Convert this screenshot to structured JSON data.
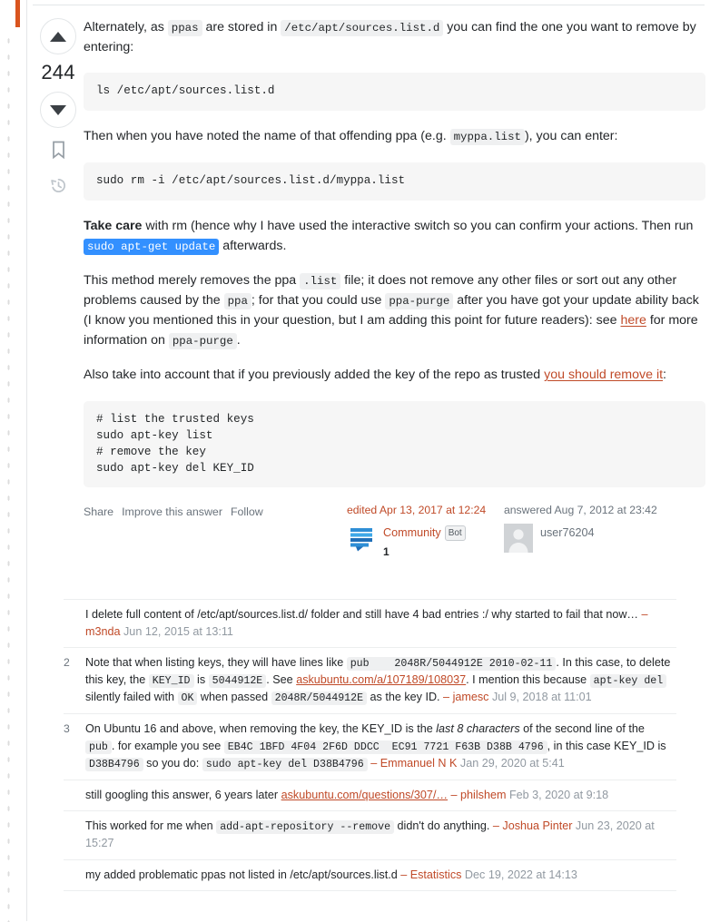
{
  "gutter": {
    "vote_count": "244",
    "upvote_label": "Up vote",
    "downvote_label": "Down vote",
    "bookmark_label": "Save this answer",
    "history_label": "Timeline"
  },
  "answer": {
    "paragraphs": {
      "p1_a": "Alternately, as ",
      "p1_code1": "ppas",
      "p1_b": " are stored in ",
      "p1_code2": "/etc/apt/sources.list.d",
      "p1_c": " you can find the one you want to remove by entering:",
      "pre1": "ls /etc/apt/sources.list.d",
      "p2_a": "Then when you have noted the name of that offending ppa (e.g. ",
      "p2_code1": "myppa.list",
      "p2_b": "), you can enter:",
      "pre2": "sudo rm -i /etc/apt/sources.list.d/myppa.list",
      "p3_bold": "Take care",
      "p3_a": " with rm (hence why I have used the interactive switch so you can confirm your actions. Then run ",
      "p3_code_selected": "sudo apt-get update",
      "p3_b": " afterwards.",
      "p4_a": "This method merely removes the ppa ",
      "p4_code1": ".list",
      "p4_b": " file; it does not remove any other files or sort out any other problems caused by the ",
      "p4_code2": "ppa",
      "p4_c": "; for that you could use ",
      "p4_code3": "ppa-purge",
      "p4_d": " after you have got your update ability back (I know you mentioned this in your question, but I am adding this point for future readers): see ",
      "p4_link": "here",
      "p4_e": " for more information on ",
      "p4_code4": "ppa-purge",
      "p4_f": ".",
      "p5_a": "Also take into account that if you previously added the key of the repo as trusted ",
      "p5_link": "you should remove it",
      "p5_b": ":",
      "pre3": "# list the trusted keys\nsudo apt-key list\n# remove the key\nsudo apt-key del KEY_ID"
    },
    "actions": {
      "share": "Share",
      "improve": "Improve this answer",
      "follow": "Follow"
    },
    "edited": {
      "when": "edited Apr 13, 2017 at 12:24",
      "user": "Community",
      "badge": "Bot",
      "rep": "1",
      "avatar_icon": "community-bot-avatar"
    },
    "answered": {
      "when": "answered Aug 7, 2012 at 23:42",
      "user": "user76204",
      "avatar_icon": "default-user-avatar"
    }
  },
  "comments": [
    {
      "score": "",
      "segments": [
        {
          "t": "text",
          "v": "I delete full content of /etc/apt/sources.list.d/ folder and still have 4 bad entries :/ why started to fail that now… "
        },
        {
          "t": "dash",
          "v": "– "
        },
        {
          "t": "user",
          "v": "m3nda"
        },
        {
          "t": "date",
          "v": " Jun 12, 2015 at 13:11"
        }
      ]
    },
    {
      "score": "2",
      "segments": [
        {
          "t": "text",
          "v": "Note that when listing keys, they will have lines like "
        },
        {
          "t": "code",
          "v": "pub    2048R/5044912E 2010-02-11"
        },
        {
          "t": "text",
          "v": ". In this case, to delete this key, the "
        },
        {
          "t": "code",
          "v": "KEY_ID"
        },
        {
          "t": "text",
          "v": " is "
        },
        {
          "t": "code",
          "v": "5044912E"
        },
        {
          "t": "text",
          "v": ". See "
        },
        {
          "t": "link",
          "v": "askubuntu.com/a/107189/108037"
        },
        {
          "t": "text",
          "v": ". I mention this because "
        },
        {
          "t": "code",
          "v": "apt-key del"
        },
        {
          "t": "text",
          "v": " silently failed with "
        },
        {
          "t": "code",
          "v": "OK"
        },
        {
          "t": "text",
          "v": " when passed "
        },
        {
          "t": "code",
          "v": "2048R/5044912E"
        },
        {
          "t": "text",
          "v": " as the key ID. "
        },
        {
          "t": "dash",
          "v": "– "
        },
        {
          "t": "user",
          "v": "jamesc"
        },
        {
          "t": "date",
          "v": " Jul 9, 2018 at 11:01"
        }
      ]
    },
    {
      "score": "3",
      "segments": [
        {
          "t": "text",
          "v": "On Ubuntu 16 and above, when removing the key, the KEY_ID is the "
        },
        {
          "t": "em",
          "v": "last 8 characters"
        },
        {
          "t": "text",
          "v": " of the second line of the "
        },
        {
          "t": "code",
          "v": "pub"
        },
        {
          "t": "text",
          "v": ". for example you see "
        },
        {
          "t": "code",
          "v": "EB4C 1BFD 4F04 2F6D DDCC  EC91 7721 F63B D38B 4796"
        },
        {
          "t": "text",
          "v": ", in this case KEY_ID is "
        },
        {
          "t": "code",
          "v": "D38B4796"
        },
        {
          "t": "text",
          "v": " so you do: "
        },
        {
          "t": "code",
          "v": "sudo apt-key del D38B4796"
        },
        {
          "t": "text",
          "v": " "
        },
        {
          "t": "dash",
          "v": "– "
        },
        {
          "t": "user",
          "v": "Emmanuel N K"
        },
        {
          "t": "date",
          "v": " Jan 29, 2020 at 5:41"
        }
      ]
    },
    {
      "score": "",
      "segments": [
        {
          "t": "text",
          "v": "still googling this answer, 6 years later "
        },
        {
          "t": "link",
          "v": "askubuntu.com/questions/307/…"
        },
        {
          "t": "text",
          "v": " "
        },
        {
          "t": "dash",
          "v": "– "
        },
        {
          "t": "user",
          "v": "philshem"
        },
        {
          "t": "date",
          "v": " Feb 3, 2020 at 9:18"
        }
      ]
    },
    {
      "score": "",
      "segments": [
        {
          "t": "text",
          "v": "This worked for me when "
        },
        {
          "t": "code",
          "v": "add-apt-repository --remove"
        },
        {
          "t": "text",
          "v": " didn't do anything. "
        },
        {
          "t": "dash",
          "v": "– "
        },
        {
          "t": "user",
          "v": "Joshua Pinter"
        },
        {
          "t": "date",
          "v": " Jun 23, 2020 at 15:27"
        }
      ]
    },
    {
      "score": "",
      "segments": [
        {
          "t": "text",
          "v": "my added problematic ppas not listed in /etc/apt/sources.list.d "
        },
        {
          "t": "dash",
          "v": "– "
        },
        {
          "t": "user",
          "v": "Estatistics"
        },
        {
          "t": "date",
          "v": " Dec 19, 2022 at 14:13"
        }
      ]
    }
  ],
  "colors": {
    "link": "#c04a28",
    "selection": "#3390ff",
    "code_bg": "#eff0f1",
    "block_bg": "#f6f6f6",
    "text": "#232629",
    "muted": "#6a737c",
    "marker": "#d9541e"
  }
}
